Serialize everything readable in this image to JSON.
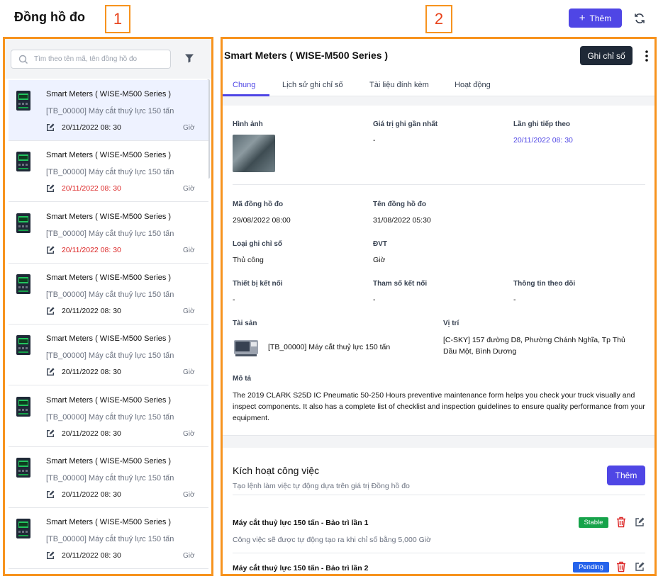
{
  "page_title": "Đồng hồ đo",
  "annotations": {
    "one": "1",
    "two": "2"
  },
  "header": {
    "add_label": "Thêm"
  },
  "search": {
    "placeholder": "Tìm theo tên mã, tên đồng hồ đo"
  },
  "list": {
    "items": [
      {
        "title": "Smart Meters ( WISE-M500 Series )",
        "subtitle": "[TB_00000] Máy cắt thuỷ lực 150 tấn",
        "date": "20/11/2022 08: 30",
        "unit": "Giờ",
        "overdue": false
      },
      {
        "title": "Smart Meters ( WISE-M500 Series )",
        "subtitle": "[TB_00000] Máy cắt thuỷ lực 150 tấn",
        "date": "20/11/2022 08: 30",
        "unit": "Giờ",
        "overdue": true
      },
      {
        "title": "Smart Meters ( WISE-M500 Series )",
        "subtitle": "[TB_00000] Máy cắt thuỷ lực 150 tấn",
        "date": "20/11/2022 08: 30",
        "unit": "Giờ",
        "overdue": true
      },
      {
        "title": "Smart Meters ( WISE-M500 Series )",
        "subtitle": "[TB_00000] Máy cắt thuỷ lực 150 tấn",
        "date": "20/11/2022 08: 30",
        "unit": "Giờ",
        "overdue": false
      },
      {
        "title": "Smart Meters ( WISE-M500 Series )",
        "subtitle": "[TB_00000] Máy cắt thuỷ lực 150 tấn",
        "date": "20/11/2022 08: 30",
        "unit": "Giờ",
        "overdue": false
      },
      {
        "title": "Smart Meters ( WISE-M500 Series )",
        "subtitle": "[TB_00000] Máy cắt thuỷ lực 150 tấn",
        "date": "20/11/2022 08: 30",
        "unit": "Giờ",
        "overdue": false
      },
      {
        "title": "Smart Meters ( WISE-M500 Series )",
        "subtitle": "[TB_00000] Máy cắt thuỷ lực 150 tấn",
        "date": "20/11/2022 08: 30",
        "unit": "Giờ",
        "overdue": false
      },
      {
        "title": "Smart Meters ( WISE-M500 Series )",
        "subtitle": "[TB_00000] Máy cắt thuỷ lực 150 tấn",
        "date": "20/11/2022 08: 30",
        "unit": "Giờ",
        "overdue": false
      }
    ]
  },
  "detail": {
    "title": "Smart Meters ( WISE-M500 Series )",
    "record_button": "Ghi chỉ số",
    "tabs": [
      "Chung",
      "Lịch sử ghi chỉ số",
      "Tài liệu đính kèm",
      "Hoạt động"
    ],
    "image_label": "Hình ảnh",
    "last_value_label": "Giá trị ghi gần nhất",
    "last_value": "-",
    "next_record_label": "Lần ghi tiếp theo",
    "next_record": "20/11/2022 08: 30",
    "meter_code_label": "Mã đồng hồ đo",
    "meter_code": "29/08/2022 08:00",
    "meter_name_label": "Tên đồng hồ đo",
    "meter_name": "31/08/2022 05:30",
    "record_type_label": "Loại ghi chỉ số",
    "record_type": "Thủ công",
    "unit_label": "ĐVT",
    "unit": "Giờ",
    "device_label": "Thiết bị kết nối",
    "device": "-",
    "param_label": "Tham số kết nối",
    "param": "-",
    "tracking_label": "Thông tin theo dõi",
    "tracking": "-",
    "asset_label": "Tài sản",
    "asset": "[TB_00000] Máy cắt thuỷ lực 150 tấn",
    "location_label": "Vị trí",
    "location": "[C-SKY] 157 đường D8, Phường Chánh Nghĩa, Tp Thủ Dầu Một, Bình Dương",
    "desc_label": "Mô tả",
    "desc": "The 2019 CLARK S25D IC Pneumatic 50-250 Hours preventive maintenance form helps you check your truck visually and inspect components. It also has a complete list of checklist and inspection guidelines to ensure quality performance from your equipment."
  },
  "activation": {
    "title": "Kích hoạt công việc",
    "subtitle": "Tạo lệnh làm việc tự động dựa trên giá trị Đồng hồ đo",
    "add_label": "Thêm",
    "rules": [
      {
        "name": "Máy cắt thuỷ lực 150 tấn - Bảo trì lần 1",
        "status": "Stable",
        "status_color": "#16a34a",
        "desc": "Công việc sẽ được tự động tạo ra khi chỉ số bằng 5,000 Giờ"
      },
      {
        "name": "Máy cắt thuỷ lực 150 tấn - Bảo trì lần 2",
        "status": "Pending",
        "status_color": "#2563eb",
        "desc": ""
      }
    ]
  },
  "colors": {
    "accent": "#4f46e5",
    "annotation": "#f7931e",
    "overdue": "#dc2626"
  }
}
